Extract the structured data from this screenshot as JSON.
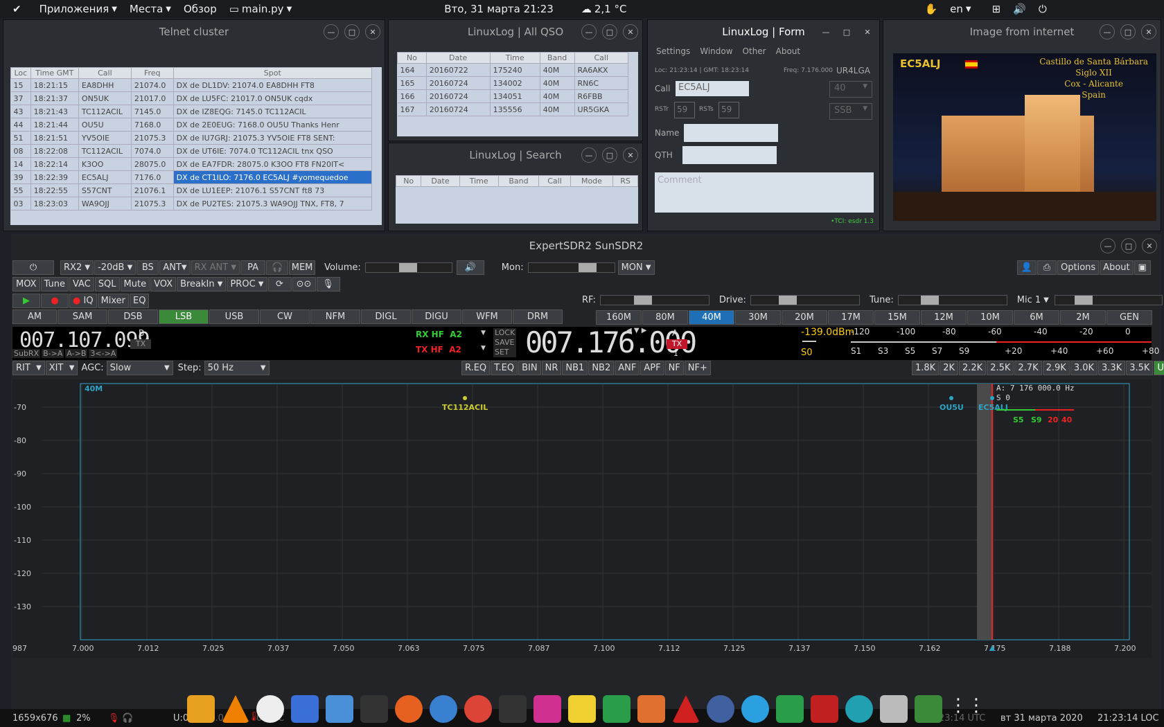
{
  "topbar": {
    "apps": "Приложения",
    "places": "Места",
    "overview": "Обзор",
    "file": "main.py",
    "datetime": "Втo, 31 марта  21:23",
    "weather": "2,1 °C",
    "lang": "en"
  },
  "telnet": {
    "title": "Telnet cluster",
    "headers": [
      "Loc",
      "Time GMT",
      "Call",
      "Freq",
      "Spot"
    ],
    "rows": [
      [
        "15",
        "18:21:15",
        "EA8DHH",
        "21074.0",
        "DX de DL1DV:   21074.0  EA8DHH      FT8"
      ],
      [
        "37",
        "18:21:37",
        "ON5UK",
        "21017.0",
        "DX de LU5FC:   21017.0  ON5UK      cqdx"
      ],
      [
        "43",
        "18:21:43",
        "TC112ACIL",
        "7145.0",
        "DX de IZ8EQG:    7145.0  TC112ACIL"
      ],
      [
        "44",
        "18:21:44",
        "OU5U",
        "7168.0",
        "DX de 2E0EUG:    7168.0  OU5U       Thanks Henr"
      ],
      [
        "51",
        "18:21:51",
        "YV5OIE",
        "21075.3",
        "DX de IU7GRJ:   21075.3  YV5OIE     FT8  SENT:"
      ],
      [
        "08",
        "18:22:08",
        "TC112ACIL",
        "7074.0",
        "DX de UT6IE:     7074.0  TC112ACIL    tnx QSO"
      ],
      [
        "14",
        "18:22:14",
        "K3OO",
        "28075.0",
        "DX de EA7FDR:   28075.0  K3OO        FT8 FN20IT<"
      ],
      [
        "39",
        "18:22:39",
        "EC5ALJ",
        "7176.0",
        "DX de CT1ILO:    7176.0  EC5ALJ      #yomequedoe"
      ],
      [
        "55",
        "18:22:55",
        "S57CNT",
        "21076.1",
        "DX de LU1EEP:   21076.1  S57CNT      ft8  73"
      ],
      [
        "03",
        "18:23:03",
        "WA9OJJ",
        "21075.3",
        "DX de PU2TES:   21075.3  WA9OJJ     TNX, FT8, 7"
      ]
    ]
  },
  "allqso": {
    "title": "LinuxLog | All QSO",
    "headers": [
      "No",
      "Date",
      "Time",
      "Band",
      "Call"
    ],
    "rows": [
      [
        "164",
        "20160722",
        "175240",
        "40M",
        "RA6AKX"
      ],
      [
        "165",
        "20160724",
        "134002",
        "40M",
        "RN6C"
      ],
      [
        "166",
        "20160724",
        "134051",
        "40M",
        "R6FBB"
      ],
      [
        "167",
        "20160724",
        "135556",
        "40M",
        "UR5GKA"
      ]
    ]
  },
  "search": {
    "title": "LinuxLog | Search",
    "headers": [
      "No",
      "Date",
      "Time",
      "Band",
      "Call",
      "Mode",
      "RS"
    ]
  },
  "form": {
    "title": "LinuxLog | Form",
    "menu": [
      "Settings",
      "Window",
      "Other",
      "About"
    ],
    "loc": "Loc: 21:23:14  |  GMT: 18:23:14",
    "freq": "Freq: 7.176.000",
    "station": "UR4LGA",
    "call_label": "Call",
    "call_value": "EC5ALJ",
    "band": "40",
    "mode": "SSB",
    "rstr_label": "RSTr",
    "rstr": "59",
    "rsts_label": "RSTs",
    "rsts": "59",
    "name_label": "Name",
    "qth_label": "QTH",
    "comment_placeholder": "Comment",
    "tci": "•TCI: esdr 1.3"
  },
  "image": {
    "title": "Image from internet",
    "callsign": "EC5ALJ",
    "caption": [
      "Castillo de Santa Bárbara",
      "Siglo XII",
      "Cox - Alicante",
      "Spain"
    ]
  },
  "sdr": {
    "title": "ExpertSDR2 SunSDR2",
    "row1": [
      "RX2",
      "-20dB",
      "BS",
      "ANT",
      "RX ANT",
      "PA",
      "MEM"
    ],
    "volume": "Volume:",
    "mon": "Mon:",
    "mon_btn": "MON",
    "options": "Options",
    "about": "About",
    "row2": [
      "MOX",
      "Tune",
      "VAC",
      "SQL",
      "Mute",
      "VOX",
      "BreakIn",
      "PROC"
    ],
    "row3": [
      "IQ",
      "Mixer",
      "EQ"
    ],
    "rf": "RF:",
    "drive": "Drive:",
    "tune": "Tune:",
    "mic": "Mic 1",
    "modes": [
      "AM",
      "SAM",
      "DSB",
      "LSB",
      "USB",
      "CW",
      "NFM",
      "DIGL",
      "DIGU",
      "WFM",
      "DRM"
    ],
    "active_mode": "LSB",
    "bands": [
      "160M",
      "80M",
      "40M",
      "30M",
      "20M",
      "17M",
      "15M",
      "12M",
      "10M",
      "6M",
      "2M",
      "GEN"
    ],
    "active_band": "40M",
    "subfreq": "007.107.099",
    "vfo_b": "B",
    "tx_small": "TX",
    "subrx": [
      "SubRX",
      "B->A",
      "A->B",
      "3<->A"
    ],
    "rx": "RX HF",
    "rx_ant": "A2",
    "tx": "TX HF",
    "tx_ant": "A2",
    "lock": [
      "LOCK",
      "SAVE",
      "SET"
    ],
    "mainfreq": "007.176.000",
    "vfo_a": "A",
    "tx_flag": "TX",
    "vfo_num": "1",
    "smeter": {
      "dbm": "-139.0dBm",
      "s": "S0",
      "top": [
        "-120",
        "-100",
        "-80",
        "-60",
        "-40",
        "-20",
        "0"
      ],
      "bottom": [
        "S1",
        "S3",
        "S5",
        "S7",
        "S9",
        "+20",
        "+40",
        "+60",
        "+80"
      ]
    },
    "row5": [
      "RIT",
      "XIT"
    ],
    "agc": "AGC:",
    "agc_val": "Slow",
    "step": "Step:",
    "step_val": "50 Hz",
    "dsp": [
      "R.EQ",
      "T.EQ",
      "BIN",
      "NR",
      "NB1",
      "NB2",
      "ANF",
      "APF",
      "NF",
      "NF+"
    ],
    "filters": [
      "1.8K",
      "2K",
      "2.2K",
      "2.5K",
      "2.7K",
      "2.9K",
      "3.0K",
      "3.3K",
      "3.5K",
      "User"
    ]
  },
  "spectrum": {
    "band": "40M",
    "vfo": "A: 7 176 000.0 Hz",
    "s": "S 0",
    "spots": [
      "TC112ACIL",
      "OU5U",
      "EC5ALJ"
    ],
    "scale": [
      "S5",
      "S9",
      "20",
      "40"
    ],
    "y": [
      "-70",
      "-80",
      "-90",
      "-100",
      "-110",
      "-120",
      "-130"
    ],
    "x": [
      "987",
      "7.000",
      "7.012",
      "7.025",
      "7.037",
      "7.050",
      "7.063",
      "7.075",
      "7.087",
      "7.100",
      "7.112",
      "7.125",
      "7.137",
      "7.150",
      "7.162",
      "7.175",
      "7.188",
      "7.200"
    ]
  },
  "statusbar": {
    "res": "1659x676",
    "cpu": "2%",
    "volt": "U:0.0V",
    "amp": "I:0.0A",
    "temp": "0.0 °C",
    "utc": "18:23:14 UTC",
    "date": "вт 31 марта 2020",
    "loc": "21:23:14 LOC"
  }
}
